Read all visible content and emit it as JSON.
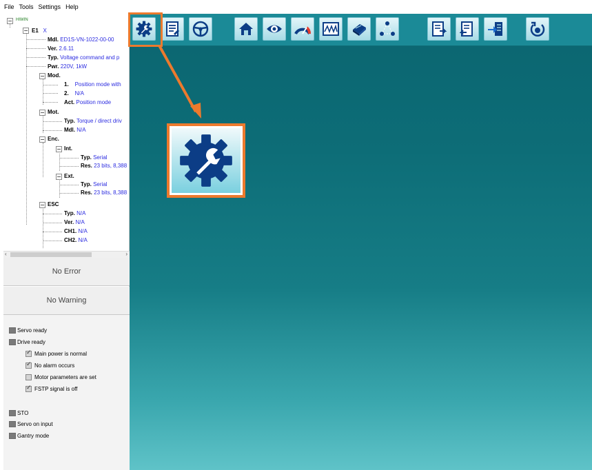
{
  "menu": [
    "File",
    "Tools",
    "Settings",
    "Help"
  ],
  "tree": {
    "root": "HIWIN",
    "device": {
      "id": "E1",
      "name": "X"
    },
    "mdl": {
      "key": "Mdl.",
      "value": "ED1S-VN-1022-00-00"
    },
    "ver": {
      "key": "Ver.",
      "value": "2.6.11"
    },
    "typ": {
      "key": "Typ.",
      "value": "Voltage command and p"
    },
    "pwr": {
      "key": "Pwr.",
      "value": "220V, 1kW"
    },
    "mod": {
      "label": "Mod.",
      "m1": {
        "key": "1.",
        "value": "Position mode with"
      },
      "m2": {
        "key": "2.",
        "value": "N/A"
      },
      "act": {
        "key": "Act.",
        "value": "Position mode"
      }
    },
    "mot": {
      "label": "Mot.",
      "typ": {
        "key": "Typ.",
        "value": "Torque / direct driv"
      },
      "mdl": {
        "key": "Mdl.",
        "value": "N/A"
      }
    },
    "enc": {
      "label": "Enc.",
      "int": {
        "label": "Int.",
        "typ": {
          "key": "Typ.",
          "value": "Serial"
        },
        "res": {
          "key": "Res.",
          "value": "23 bits, 8,388"
        }
      },
      "ext": {
        "label": "Ext.",
        "typ": {
          "key": "Typ.",
          "value": "Serial"
        },
        "res": {
          "key": "Res.",
          "value": "23 bits, 8,388"
        }
      }
    },
    "esc": {
      "label": "ESC",
      "typ": {
        "key": "Typ.",
        "value": "N/A"
      },
      "ver": {
        "key": "Ver.",
        "value": "N/A"
      },
      "ch1": {
        "key": "CH1.",
        "value": "N/A"
      },
      "ch2": {
        "key": "CH2.",
        "value": "N/A"
      }
    }
  },
  "error_text": "No Error",
  "warning_text": "No Warning",
  "status": {
    "servo_ready": "Servo ready",
    "drive_ready": "Drive ready",
    "main_power": "Main power is normal",
    "no_alarm": "No alarm occurs",
    "motor_params": "Motor parameters are set",
    "fstp": "FSTP signal is off",
    "sto": "STO",
    "servo_on": "Servo on input",
    "gantry": "Gantry mode"
  },
  "toolbar_icons": [
    "configuration-wrench-gear-icon",
    "parameter-document-icon",
    "steering-wheel-icon",
    "home-icon",
    "eye-monitor-icon",
    "gauge-icon",
    "scope-waveform-icon",
    "motor-icon",
    "network-nodes-icon",
    "export-document-icon",
    "import-document-icon",
    "load-arrow-icon",
    "power-reset-icon"
  ],
  "colors": {
    "highlight": "#ec7a2d",
    "workspace": "#0b6570",
    "toolbar": "#1b8a97",
    "icon_dark": "#0c3d86",
    "link_blue": "#2c2ce0"
  }
}
